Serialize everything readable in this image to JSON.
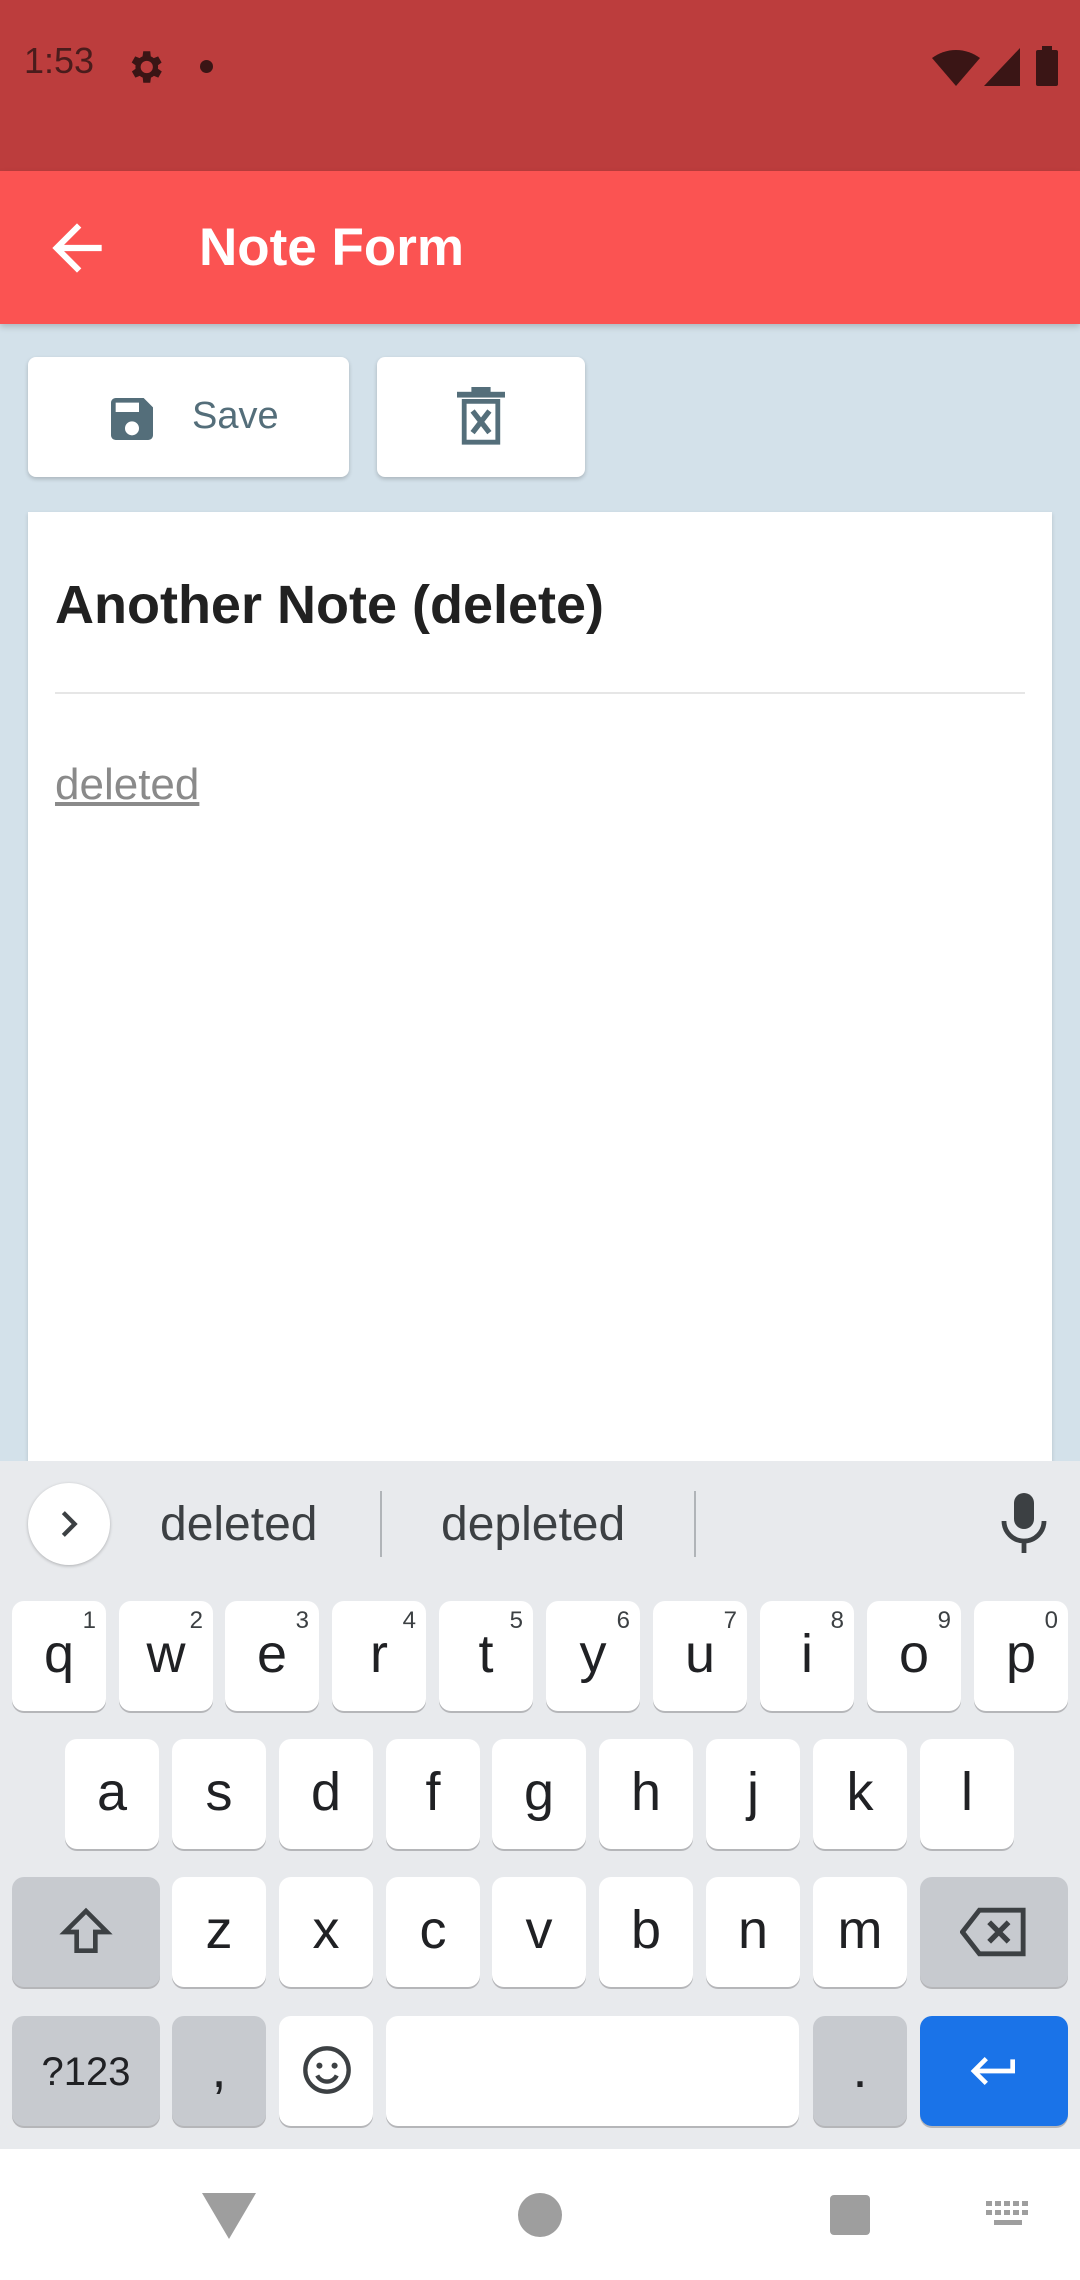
{
  "status_bar": {
    "time": "1:53",
    "icons": [
      "gear-icon",
      "dot-icon",
      "wifi-icon",
      "signal-icon",
      "battery-icon"
    ]
  },
  "app_bar": {
    "title": "Note Form",
    "back_icon": "arrow-left-icon",
    "color": "#fb5352"
  },
  "toolbar": {
    "save_label": "Save",
    "save_icon": "floppy-disk-icon",
    "delete_icon": "trash-x-icon"
  },
  "note": {
    "title": "Another Note (delete)",
    "body": "deleted"
  },
  "keyboard": {
    "suggestions": [
      "deleted",
      "depleted"
    ],
    "rows": [
      [
        {
          "k": "q",
          "h": "1"
        },
        {
          "k": "w",
          "h": "2"
        },
        {
          "k": "e",
          "h": "3"
        },
        {
          "k": "r",
          "h": "4"
        },
        {
          "k": "t",
          "h": "5"
        },
        {
          "k": "y",
          "h": "6"
        },
        {
          "k": "u",
          "h": "7"
        },
        {
          "k": "i",
          "h": "8"
        },
        {
          "k": "o",
          "h": "9"
        },
        {
          "k": "p",
          "h": "0"
        }
      ],
      [
        {
          "k": "a"
        },
        {
          "k": "s"
        },
        {
          "k": "d"
        },
        {
          "k": "f"
        },
        {
          "k": "g"
        },
        {
          "k": "h"
        },
        {
          "k": "j"
        },
        {
          "k": "k"
        },
        {
          "k": "l"
        }
      ],
      [
        {
          "k": "z"
        },
        {
          "k": "x"
        },
        {
          "k": "c"
        },
        {
          "k": "v"
        },
        {
          "k": "b"
        },
        {
          "k": "n"
        },
        {
          "k": "m"
        }
      ]
    ],
    "symbols_label": "?123",
    "comma_label": ",",
    "period_label": ".",
    "enter_color": "#1a73e8"
  },
  "nav_bar": {
    "icons": [
      "nav-back-icon",
      "nav-home-icon",
      "nav-recents-icon",
      "keyboard-switch-icon"
    ]
  }
}
